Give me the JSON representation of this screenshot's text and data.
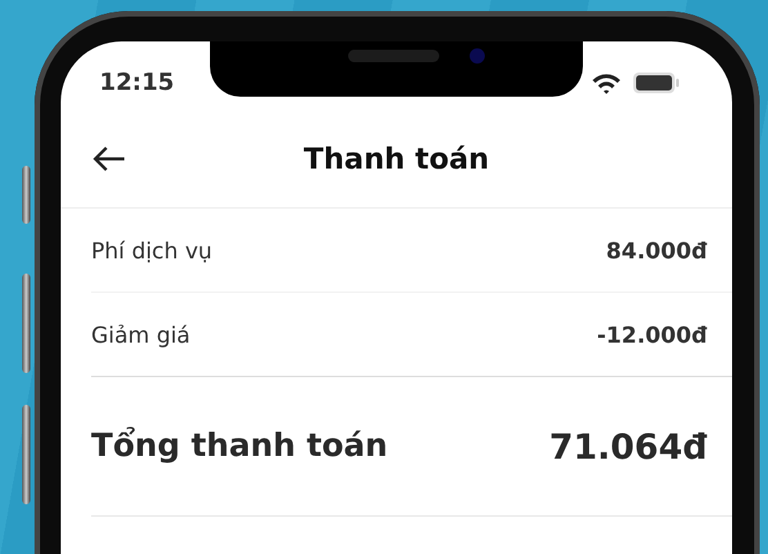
{
  "status_bar": {
    "time": "12:15"
  },
  "header": {
    "title": "Thanh toán"
  },
  "fee_rows": [
    {
      "label": "Phí dịch vụ",
      "value": "84.000đ"
    },
    {
      "label": "Giảm giá",
      "value": "-12.000đ"
    }
  ],
  "total": {
    "label": "Tổng thanh toán",
    "value": "71.064đ"
  }
}
